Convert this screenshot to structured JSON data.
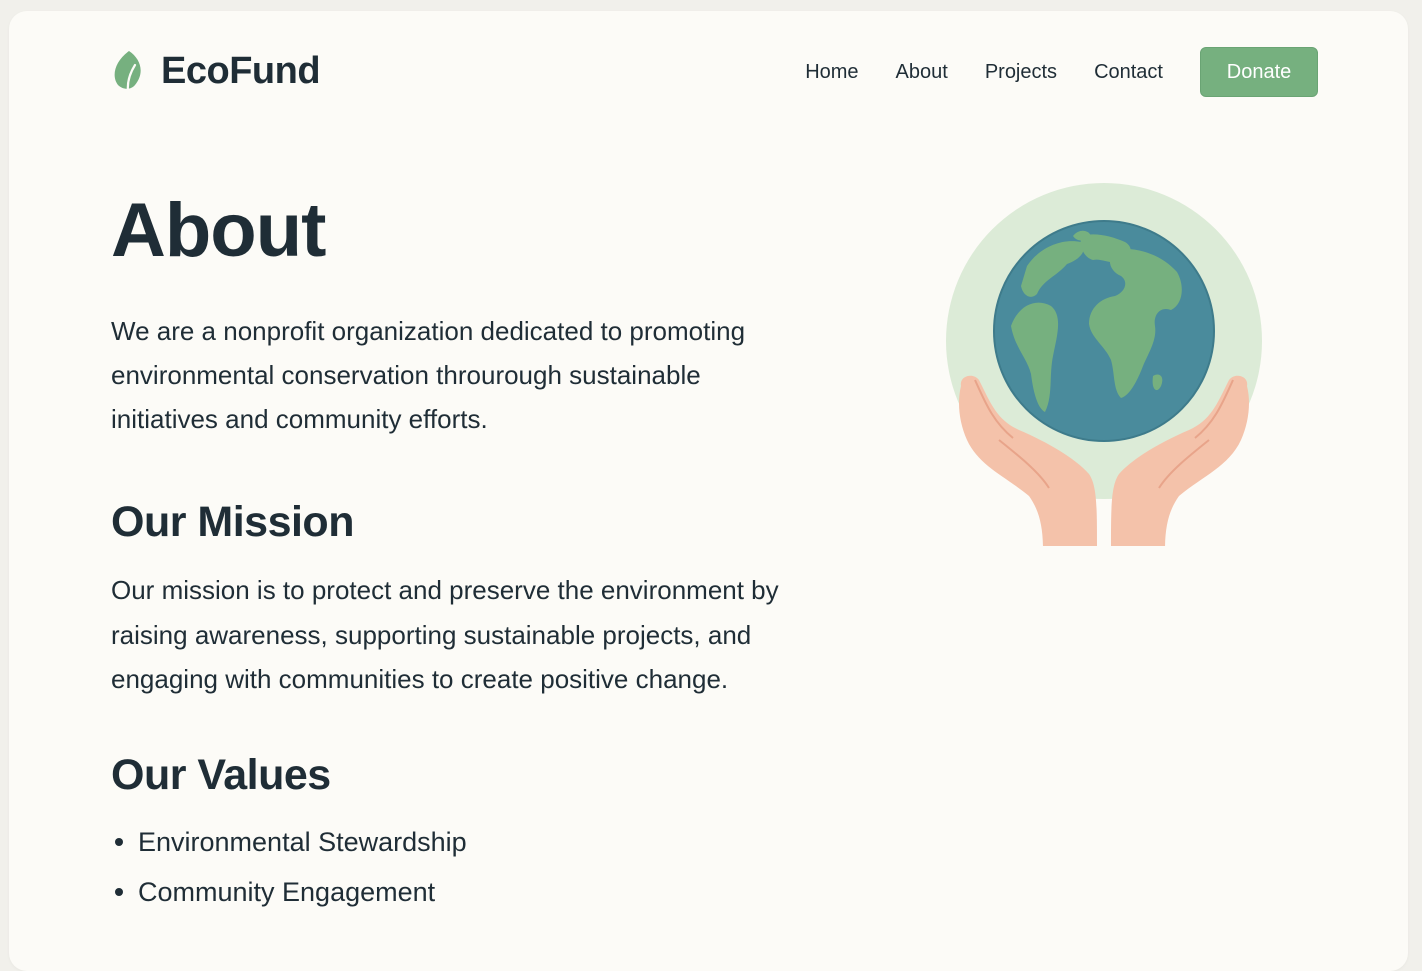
{
  "brand": {
    "name": "EcoFund",
    "logo_icon": "leaf-icon",
    "accent_color": "#76b07f"
  },
  "nav": {
    "items": [
      {
        "label": "Home"
      },
      {
        "label": "About"
      },
      {
        "label": "Projects"
      },
      {
        "label": "Contact"
      }
    ],
    "donate_label": "Donate"
  },
  "about": {
    "title": "About",
    "intro": "We are a nonprofit organization dedicated to promoting environmental conservation throurough sustainable initiatives and community efforts."
  },
  "mission": {
    "title": "Our Mission",
    "text": "Our mission is to protect and preserve the environment by raising awareness, supporting sustainable projects, and engaging with communities to create positive change."
  },
  "values": {
    "title": "Our Values",
    "items": [
      {
        "label": "Environmental Stewardship"
      },
      {
        "label": "Community Engagement"
      }
    ]
  },
  "illustration": {
    "icon": "hands-holding-earth-icon"
  }
}
